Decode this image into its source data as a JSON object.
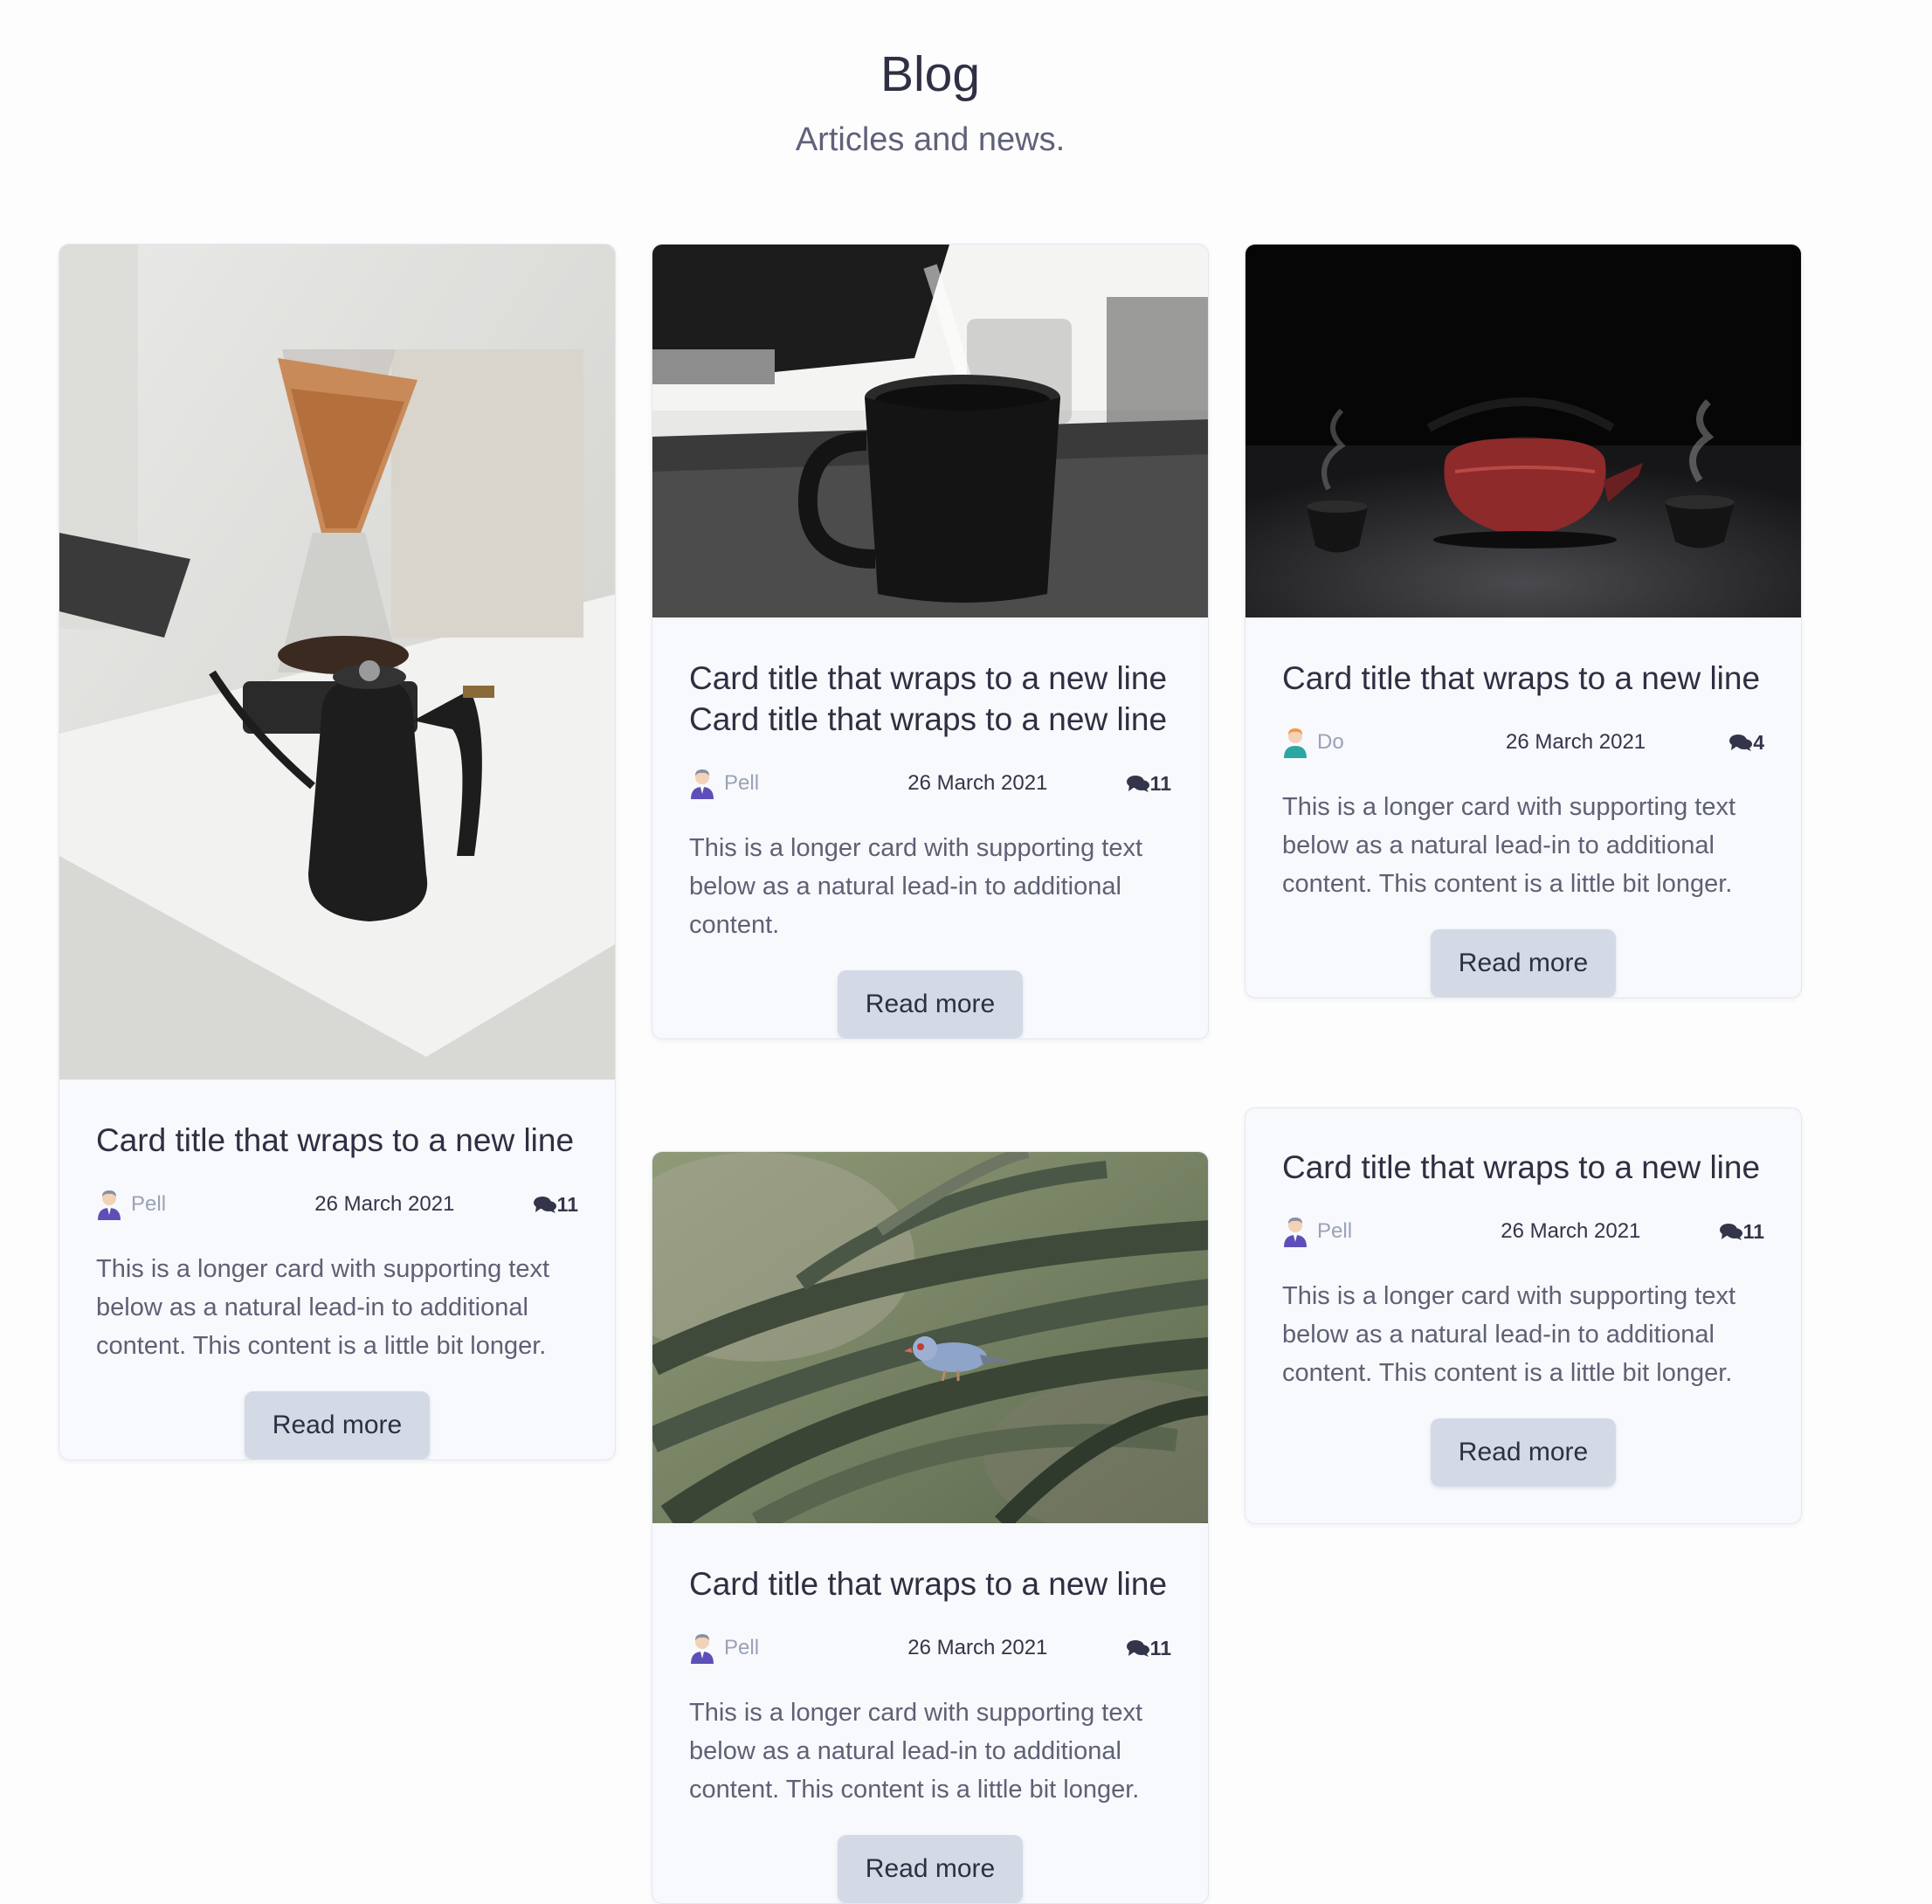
{
  "header": {
    "title": "Blog",
    "subtitle": "Articles and news."
  },
  "cards": [
    {
      "image": "coffee-kettle-photo",
      "title": "Card title that wraps to a new line",
      "author": "Pell",
      "date": "26 March 2021",
      "comments": "11",
      "text": "This is a longer card with supporting text below as a natural lead-in to additional content. This content is a little bit longer.",
      "button": "Read more"
    },
    {
      "image": "black-mug-photo",
      "title": "Card title that wraps to a new line Card title that wraps to a new line",
      "author": "Pell",
      "date": "26 March 2021",
      "comments": "11",
      "text": "This is a longer card with supporting text below as a natural lead-in to additional content.",
      "button": "Read more"
    },
    {
      "image": "red-teapot-photo",
      "title": "Card title that wraps to a new line",
      "author": "Do",
      "date": "26 March 2021",
      "comments": "4",
      "text": "This is a longer card with supporting text below as a natural lead-in to additional content. This content is a little bit longer.",
      "button": "Read more"
    },
    {
      "image": "bird-on-aloe-photo",
      "title": "Card title that wraps to a new line",
      "author": "Pell",
      "date": "26 March 2021",
      "comments": "11",
      "text": "This is a longer card with supporting text below as a natural lead-in to additional content. This content is a little bit longer.",
      "button": "Read more"
    },
    {
      "image": "",
      "title": "Card title that wraps to a new line",
      "author": "Pell",
      "date": "26 March 2021",
      "comments": "11",
      "text": "This is a longer card with supporting text below as a natural lead-in to additional content. This content is a little bit longer.",
      "button": "Read more"
    }
  ],
  "colors": {
    "button_bg": "#d4d9e6",
    "card_bg": "#f7f9fc",
    "author_text": "#9aa2b5"
  }
}
